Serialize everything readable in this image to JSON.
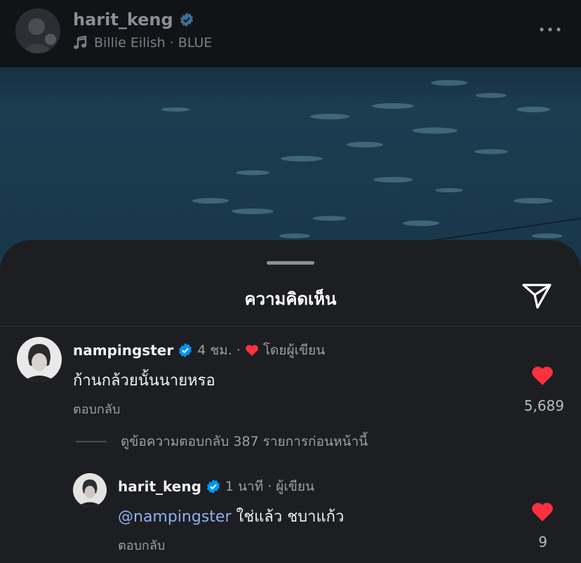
{
  "header": {
    "username": "harit_keng",
    "song": "Billie Eilish · BLUE"
  },
  "sheet": {
    "title": "ความคิดเห็น"
  },
  "comments": [
    {
      "username": "nampingster",
      "time": "4 ชม.",
      "separator": "·",
      "liked_by_author": "โดยผู้เขียน",
      "text": "ก้านกล้วยนั้นนายหรอ",
      "reply_label": "ตอบกลับ",
      "likes": "5,689"
    }
  ],
  "view_replies": "ดูข้อความตอบกลับ 387 รายการก่อนหน้านี้",
  "reply": {
    "username": "harit_keng",
    "time": "1 นาที",
    "separator": "·",
    "author_label": "ผู้เขียน",
    "mention": "@nampingster",
    "text": " ใช่แล้ว ชบาแก้ว",
    "reply_label": "ตอบกลับ",
    "likes": "9"
  },
  "colors": {
    "heart": "#ff3040",
    "verified": "#0095f6",
    "mention": "#8fb0f0"
  }
}
